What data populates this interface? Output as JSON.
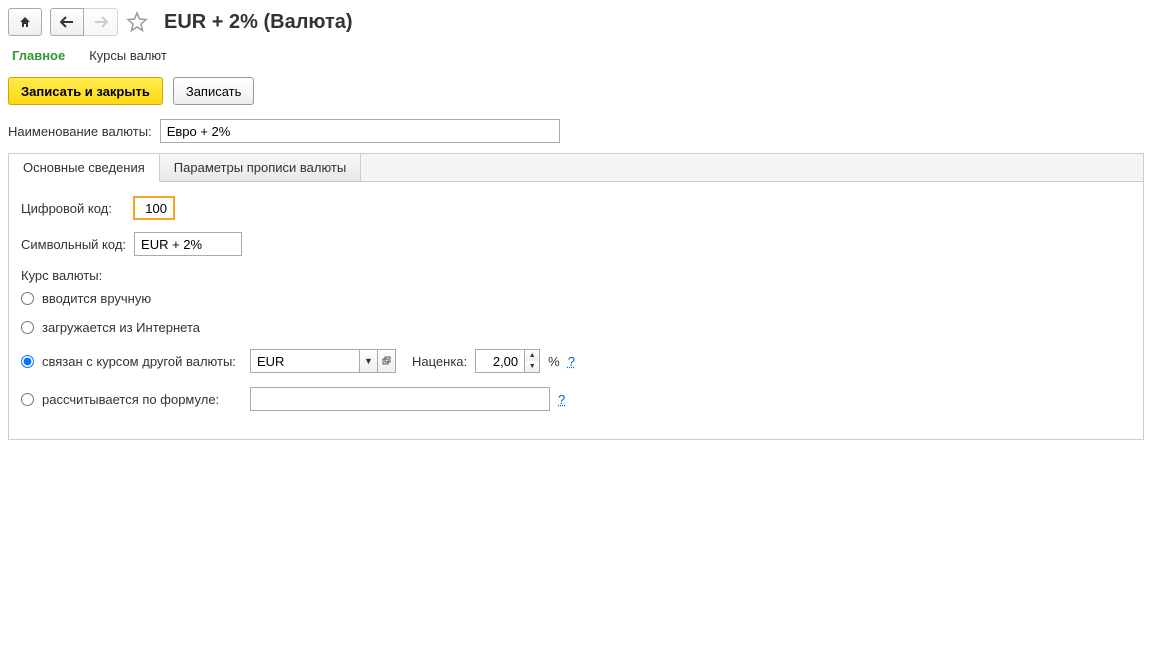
{
  "header": {
    "title": "EUR + 2% (Валюта)"
  },
  "nav_tabs": {
    "main": "Главное",
    "rates": "Курсы валют"
  },
  "toolbar": {
    "save_close": "Записать и закрыть",
    "save": "Записать"
  },
  "form": {
    "name_label": "Наименование валюты:",
    "name_value": "Евро + 2%"
  },
  "panel_tabs": {
    "basic": "Основные сведения",
    "spelling": "Параметры прописи валюты"
  },
  "fields": {
    "numeric_code_label": "Цифровой код:",
    "numeric_code_value": "100",
    "symbol_code_label": "Символьный код:",
    "symbol_code_value": "EUR + 2%",
    "rate_label": "Курс валюты:",
    "radio_manual": "вводится вручную",
    "radio_internet": "загружается из Интернета",
    "radio_linked": "связан с курсом другой валюты:",
    "linked_currency": "EUR",
    "markup_label": "Наценка:",
    "markup_value": "2,00",
    "percent": "%",
    "help": "?",
    "radio_formula": "рассчитывается по формуле:",
    "formula_value": ""
  }
}
